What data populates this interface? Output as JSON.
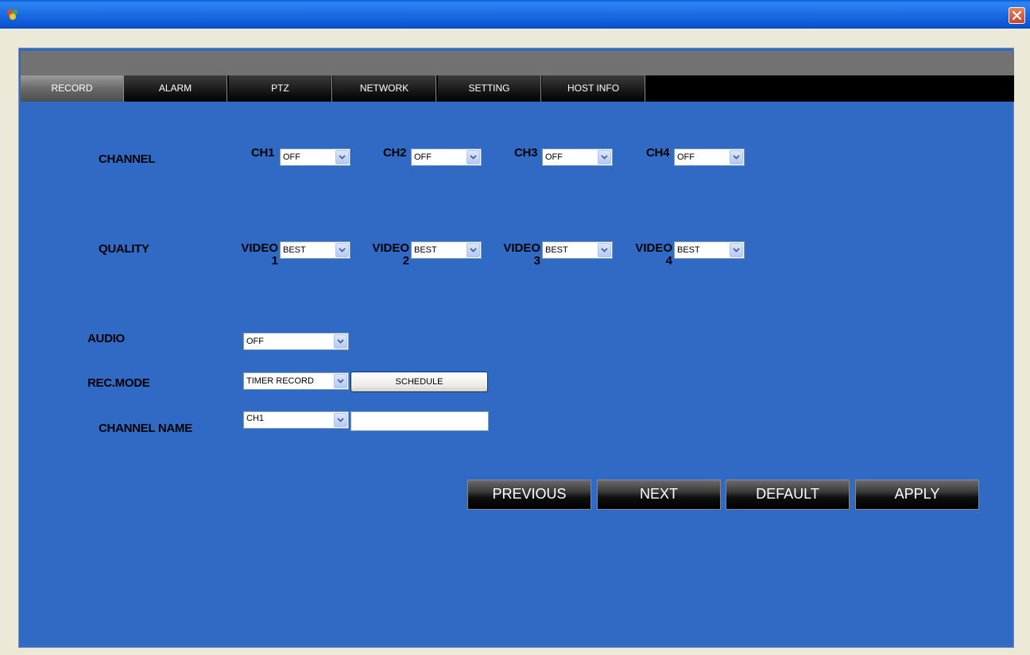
{
  "window": {
    "close_label": "close"
  },
  "tabs": [
    {
      "label": "RECORD",
      "active": true
    },
    {
      "label": "ALARM"
    },
    {
      "label": "PTZ"
    },
    {
      "label": "NETWORK"
    },
    {
      "label": "SETTING"
    },
    {
      "label": "HOST INFO"
    }
  ],
  "channel": {
    "label": "CHANNEL",
    "items": [
      {
        "name": "CH1",
        "value": "OFF"
      },
      {
        "name": "CH2",
        "value": "OFF"
      },
      {
        "name": "CH3",
        "value": "OFF"
      },
      {
        "name": "CH4",
        "value": "OFF"
      }
    ]
  },
  "quality": {
    "label": "QUALITY",
    "items": [
      {
        "name": "VIDEO",
        "num": "1",
        "value": "BEST"
      },
      {
        "name": "VIDEO",
        "num": "2",
        "value": "BEST"
      },
      {
        "name": "VIDEO",
        "num": "3",
        "value": "BEST"
      },
      {
        "name": "VIDEO",
        "num": "4",
        "value": "BEST"
      }
    ]
  },
  "audio": {
    "label": "AUDIO",
    "value": "OFF"
  },
  "rec_mode": {
    "label": "REC.MODE",
    "value": "TIMER RECORD",
    "schedule_label": "SCHEDULE"
  },
  "channel_name": {
    "label": "CHANNEL NAME",
    "value": "CH1",
    "text": ""
  },
  "actions": {
    "previous": "PREVIOUS",
    "next": "NEXT",
    "default": "DEFAULT",
    "apply": "APPLY"
  },
  "colors": {
    "panel": "#316ac5",
    "titlebar": "#0b56d3",
    "tab_active": "#6a6a6a",
    "close": "#c94420"
  }
}
